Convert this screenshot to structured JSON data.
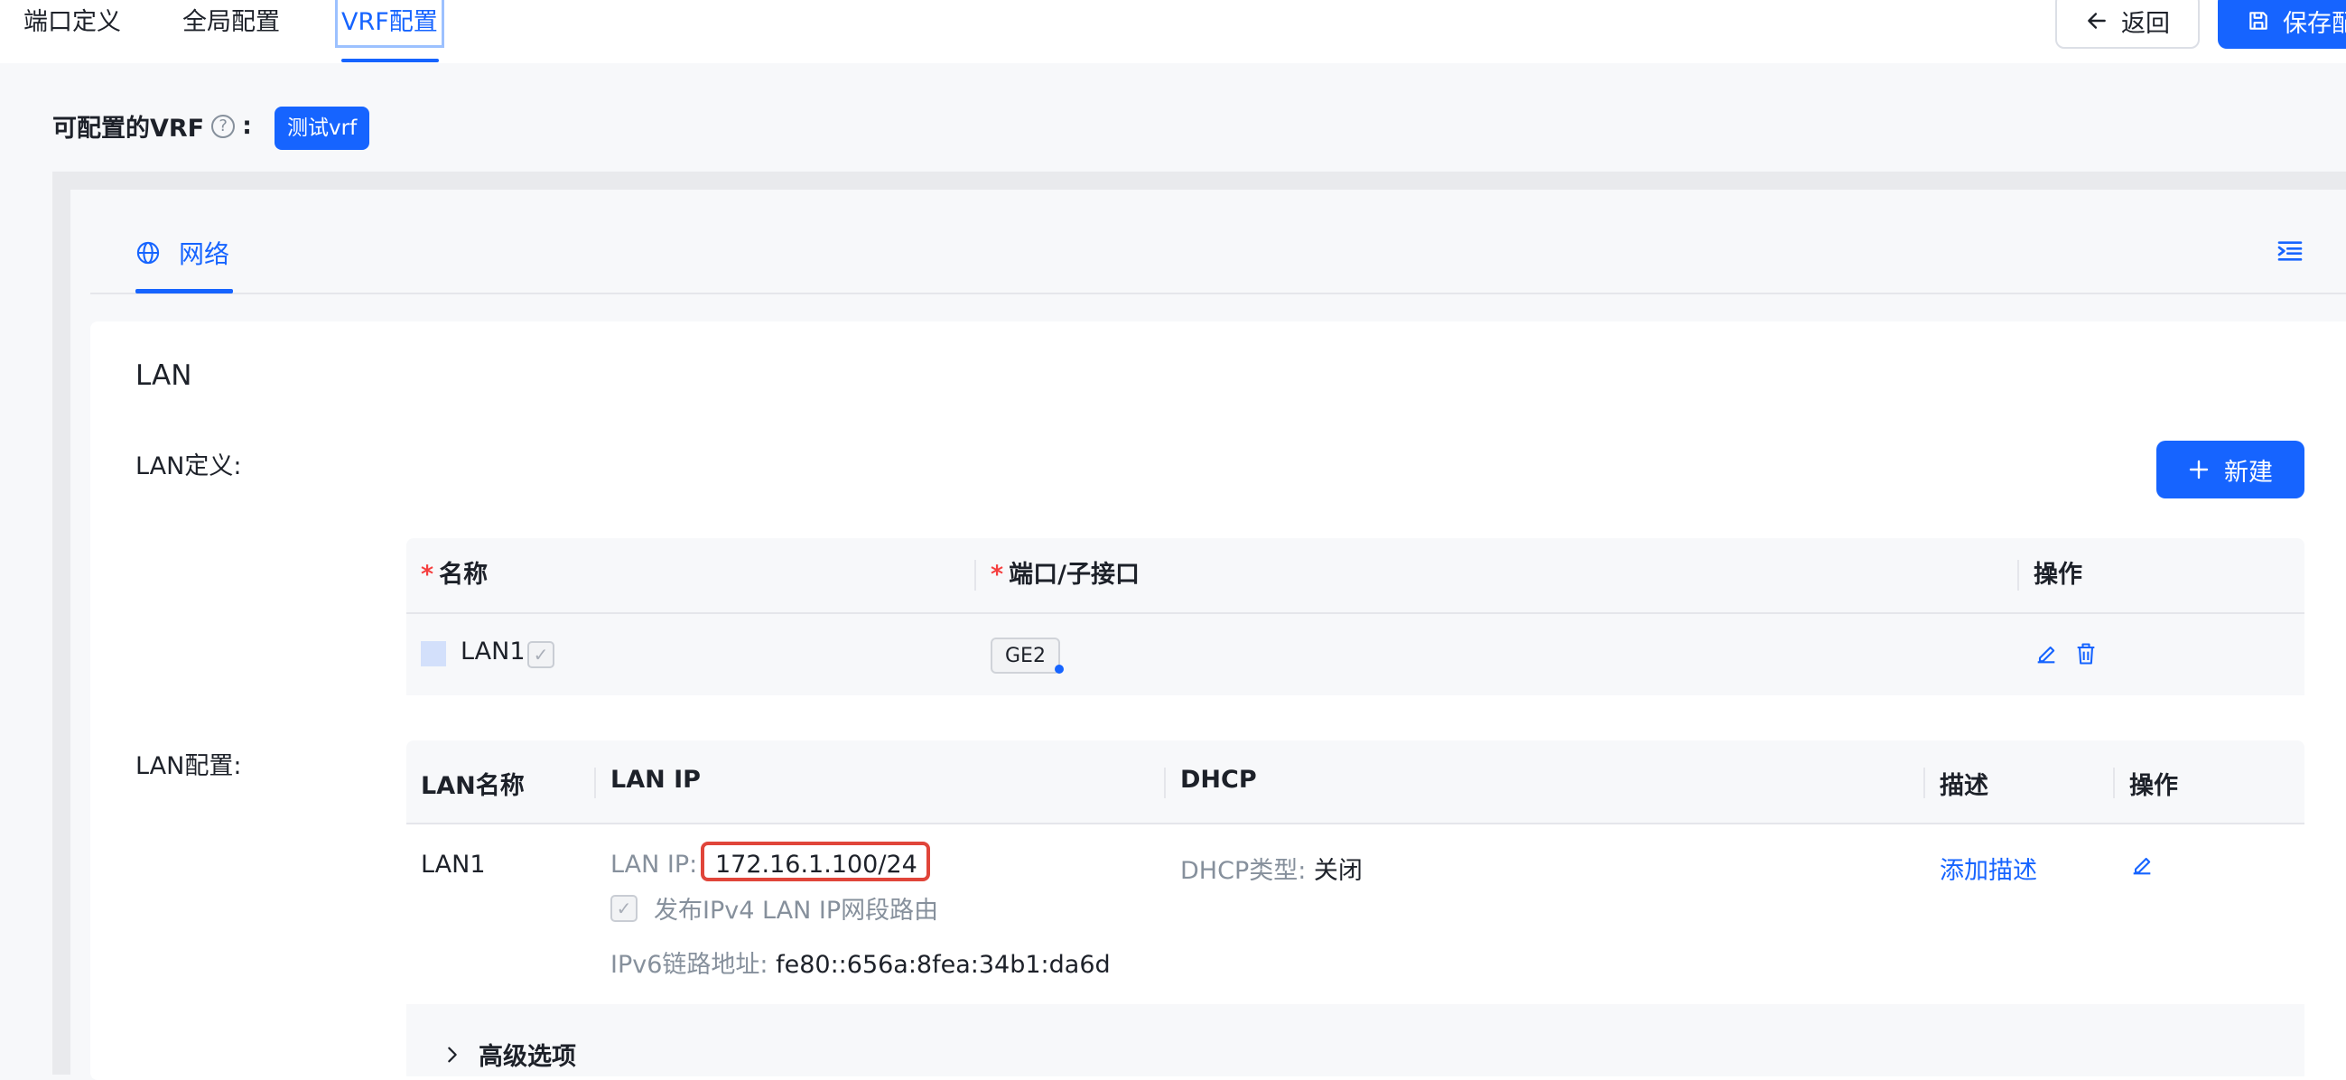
{
  "top_tabs": [
    {
      "label": "端口定义"
    },
    {
      "label": "全局配置"
    },
    {
      "label": "VRF配置",
      "active": true
    }
  ],
  "header_buttons": {
    "back": "返回",
    "save": "保存配"
  },
  "vrf": {
    "label": "可配置的VRF",
    "colon": ":",
    "tag": "测试vrf"
  },
  "network_tab": {
    "label": "网络"
  },
  "lan": {
    "title": "LAN",
    "def_label": "LAN定义:",
    "new_button": "新建",
    "def_table": {
      "headers": {
        "name": "名称",
        "port": "端口/子接口",
        "action": "操作"
      },
      "rows": [
        {
          "name": "LAN1",
          "port": "GE2",
          "swatch_color": "#d3e0fb"
        }
      ]
    },
    "cfg_label": "LAN配置:",
    "cfg_table": {
      "headers": {
        "lan_name": "LAN名称",
        "lan_ip": "LAN IP",
        "dhcp": "DHCP",
        "desc": "描述",
        "action": "操作"
      },
      "rows": [
        {
          "lan_name": "LAN1",
          "ip_label": "LAN IP:",
          "ip_value": "172.16.1.100/24",
          "publish_route": "发布IPv4 LAN IP网段路由",
          "ipv6_label": "IPv6链路地址:",
          "ipv6_value": "fe80::656a:8fea:34b1:da6d",
          "dhcp_label": "DHCP类型:",
          "dhcp_value": "关闭",
          "desc_link": "添加描述"
        }
      ]
    },
    "advanced": "高级选项"
  },
  "colors": {
    "primary": "#1664ff",
    "highlight_box": "#e0453a",
    "required": "#f53f3f"
  }
}
